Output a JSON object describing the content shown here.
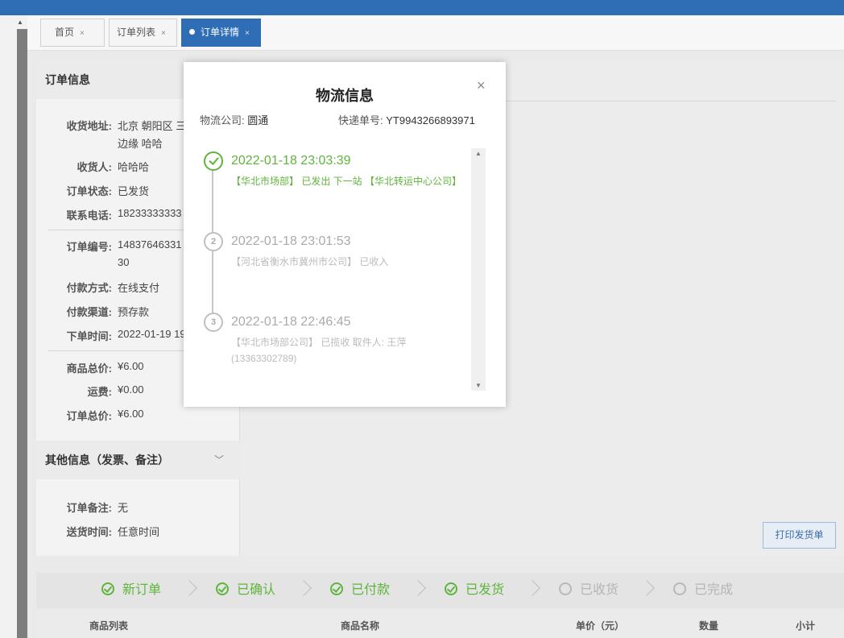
{
  "tabs": [
    {
      "label": "首页",
      "close": "×"
    },
    {
      "label": "订单列表",
      "close": "×"
    },
    {
      "label": "订单详情",
      "close": "×"
    }
  ],
  "order_info": {
    "heading": "订单信息",
    "rows": [
      {
        "label": "收货地址:",
        "value": "北京 朝阳区 三",
        "value2": "边缘 哈哈"
      },
      {
        "label": "收货人:",
        "value": "哈哈哈"
      },
      {
        "label": "订单状态:",
        "value": "已发货"
      },
      {
        "label": "联系电话:",
        "value": "18233333333"
      },
      {
        "label": "订单编号:",
        "value": "14837646331",
        "value2": "30"
      },
      {
        "label": "付款方式:",
        "value": "在线支付"
      },
      {
        "label": "付款渠道:",
        "value": "预存款"
      },
      {
        "label": "下单时间:",
        "value": "2022-01-19 19"
      },
      {
        "label": "商品总价:",
        "value": "¥6.00"
      },
      {
        "label": "运费:",
        "value": "¥0.00"
      },
      {
        "label": "订单总价:",
        "value": "¥6.00"
      }
    ]
  },
  "other_info": {
    "heading": "其他信息（发票、备注）",
    "rows": [
      {
        "label": "订单备注:",
        "value": "无"
      },
      {
        "label": "送货时间:",
        "value": "任意时间"
      }
    ]
  },
  "print_button": "打印发货单",
  "steps": [
    {
      "label": "新订单",
      "done": true
    },
    {
      "label": "已确认",
      "done": true
    },
    {
      "label": "已付款",
      "done": true
    },
    {
      "label": "已发货",
      "done": true
    },
    {
      "label": "已收货",
      "done": false
    },
    {
      "label": "已完成",
      "done": false
    }
  ],
  "table_headers": [
    "商品列表",
    "商品名称",
    "单价（元）",
    "数量",
    "小计"
  ],
  "modal": {
    "title": "物流信息",
    "close": "×",
    "company_label": "物流公司:",
    "company": "圆通",
    "tracking_label": "快递单号:",
    "tracking": "YT9943266893971",
    "events": [
      {
        "index": "1",
        "time": "2022-01-18 23:03:39",
        "desc": "【华北市场部】 已发出 下一站 【华北转运中心公司】",
        "active": true
      },
      {
        "index": "2",
        "time": "2022-01-18 23:01:53",
        "desc": "【河北省衡水市冀州市公司】 已收入",
        "active": false
      },
      {
        "index": "3",
        "time": "2022-01-18 22:46:45",
        "desc": "【华北市场部公司】 已揽收 取件人: 王萍 (13363302789)",
        "active": false
      }
    ]
  },
  "colors": {
    "brand": "#2f6eb5",
    "success": "#5fb53c",
    "muted": "#b5b5b5"
  },
  "icons": [
    "close-icon",
    "check-circle-icon",
    "chevron-down-icon",
    "chevron-right-icon",
    "scroll-up-icon",
    "scroll-down-icon"
  ]
}
